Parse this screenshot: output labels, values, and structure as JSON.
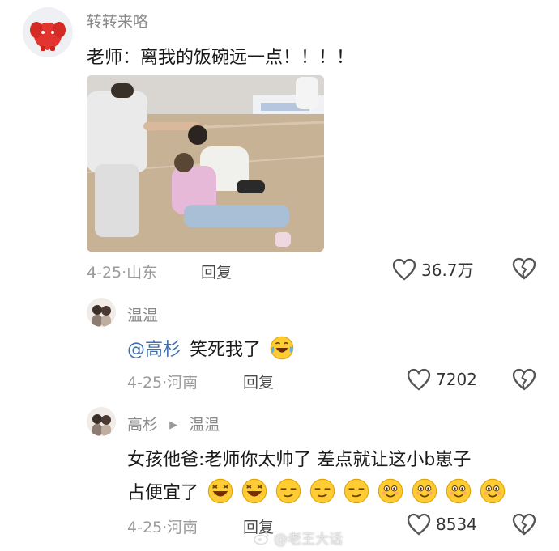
{
  "comment1": {
    "username": "转转来咯",
    "text": "老师：离我的饭碗远一点！！！！",
    "date_location": "4-25·山东",
    "reply_label": "回复",
    "likes": "36.7万"
  },
  "reply1": {
    "username": "温温",
    "mention": "@高杉",
    "text": "笑死我了",
    "emoji": "joy-tears-emoji",
    "date_location": "4-25·河南",
    "reply_label": "回复",
    "likes": "7202"
  },
  "reply2": {
    "username": "高杉",
    "reply_to": "温温",
    "text_line1": "女孩他爸:老师你太帅了 差点就让这小b崽子",
    "text_line2": "占便宜了",
    "emojis": [
      "laugh-emoji",
      "laugh-emoji",
      "smirk-emoji",
      "smirk-emoji",
      "smirk-emoji",
      "grin-emoji",
      "grin-emoji",
      "grin-emoji",
      "grin-emoji"
    ],
    "date_location": "4-25·河南",
    "reply_label": "回复",
    "likes": "8534"
  },
  "watermark": "@老王大话",
  "colors": {
    "accent_link": "#3e6fb0",
    "meta_gray": "#9b9b9b",
    "avatar_red": "#e2352f"
  }
}
